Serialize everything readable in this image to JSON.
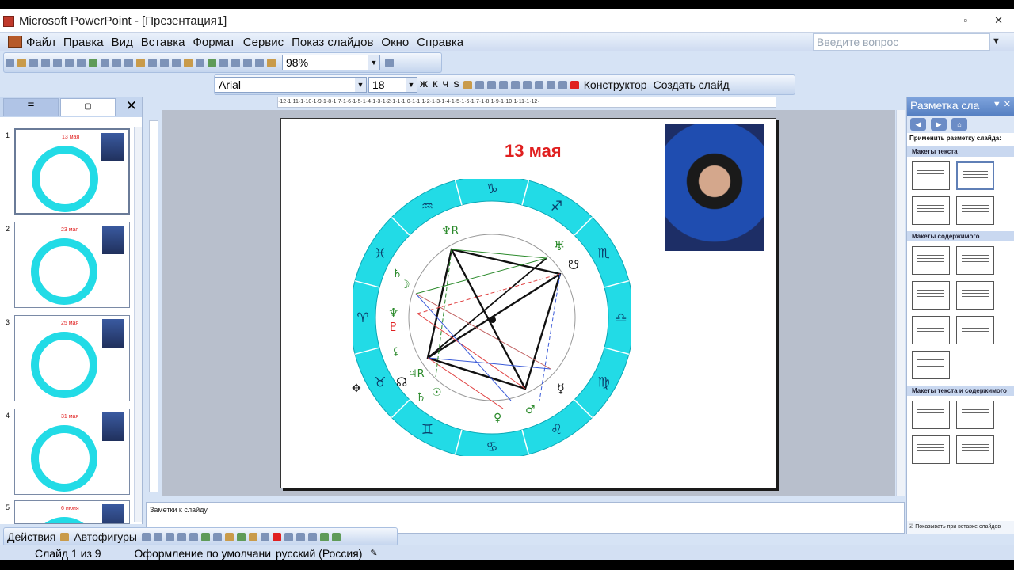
{
  "window": {
    "title": "Microsoft PowerPoint - [Презентация1]",
    "controls": [
      "–",
      "▫",
      "✕"
    ]
  },
  "menu": {
    "items": [
      "Файл",
      "Правка",
      "Вид",
      "Вставка",
      "Формат",
      "Сервис",
      "Показ слайдов",
      "Окно",
      "Справка"
    ],
    "ask_placeholder": "Введите вопрос"
  },
  "toolbar": {
    "zoom": "98%",
    "font": "Arial",
    "font_size": "18",
    "designer": "Конструктор",
    "new_slide": "Создать слайд",
    "bold": "Ж",
    "italic": "К",
    "underline": "Ч",
    "shadow": "S"
  },
  "thumbnails": [
    {
      "number": "1",
      "date": "13 мая"
    },
    {
      "number": "2",
      "date": "23 мая"
    },
    {
      "number": "3",
      "date": "25 мая"
    },
    {
      "number": "4",
      "date": "31 мая"
    },
    {
      "number": "5",
      "date": "6 июня"
    }
  ],
  "ruler_text": "·12·1·11·1·10·1·9·1·8·1·7·1·6·1·5·1·4·1·3·1·2·1·1·1·0·1·1·1·2·1·3·1·4·1·5·1·6·1·7·1·8·1·9·1·10·1·11·1·12·",
  "slide": {
    "date": "13 мая",
    "zodiac_ring": [
      "♑",
      "♐",
      "♏",
      "♎",
      "♍",
      "♌",
      "♋",
      "♊",
      "♉",
      "♈",
      "♓",
      "♒"
    ],
    "planet_glyphs": [
      "♆R",
      "♅",
      "☋",
      "♄",
      "☽",
      "♆",
      "♇",
      "⚸",
      "♃R",
      "☊",
      "♄",
      "☉",
      "♀",
      "♂",
      "☿"
    ]
  },
  "notes": {
    "placeholder": "Заметки к слайду"
  },
  "taskpane": {
    "title": "Разметка сла",
    "apply_label": "Применить разметку слайда:",
    "sections": [
      "Макеты текста",
      "Макеты содержимого",
      "Макеты текста и содержимого"
    ],
    "show_on_insert": "Показывать при вставке слайдов"
  },
  "drawbar": {
    "actions": "Действия",
    "autoshapes": "Автофигуры"
  },
  "status": {
    "slide_info": "Слайд 1 из 9",
    "design": "Оформление по умолчани",
    "language": "русский (Россия)"
  },
  "colors": {
    "accent": "#22dbe6",
    "date_red": "#e02020",
    "chrome": "#d6e3f5"
  }
}
